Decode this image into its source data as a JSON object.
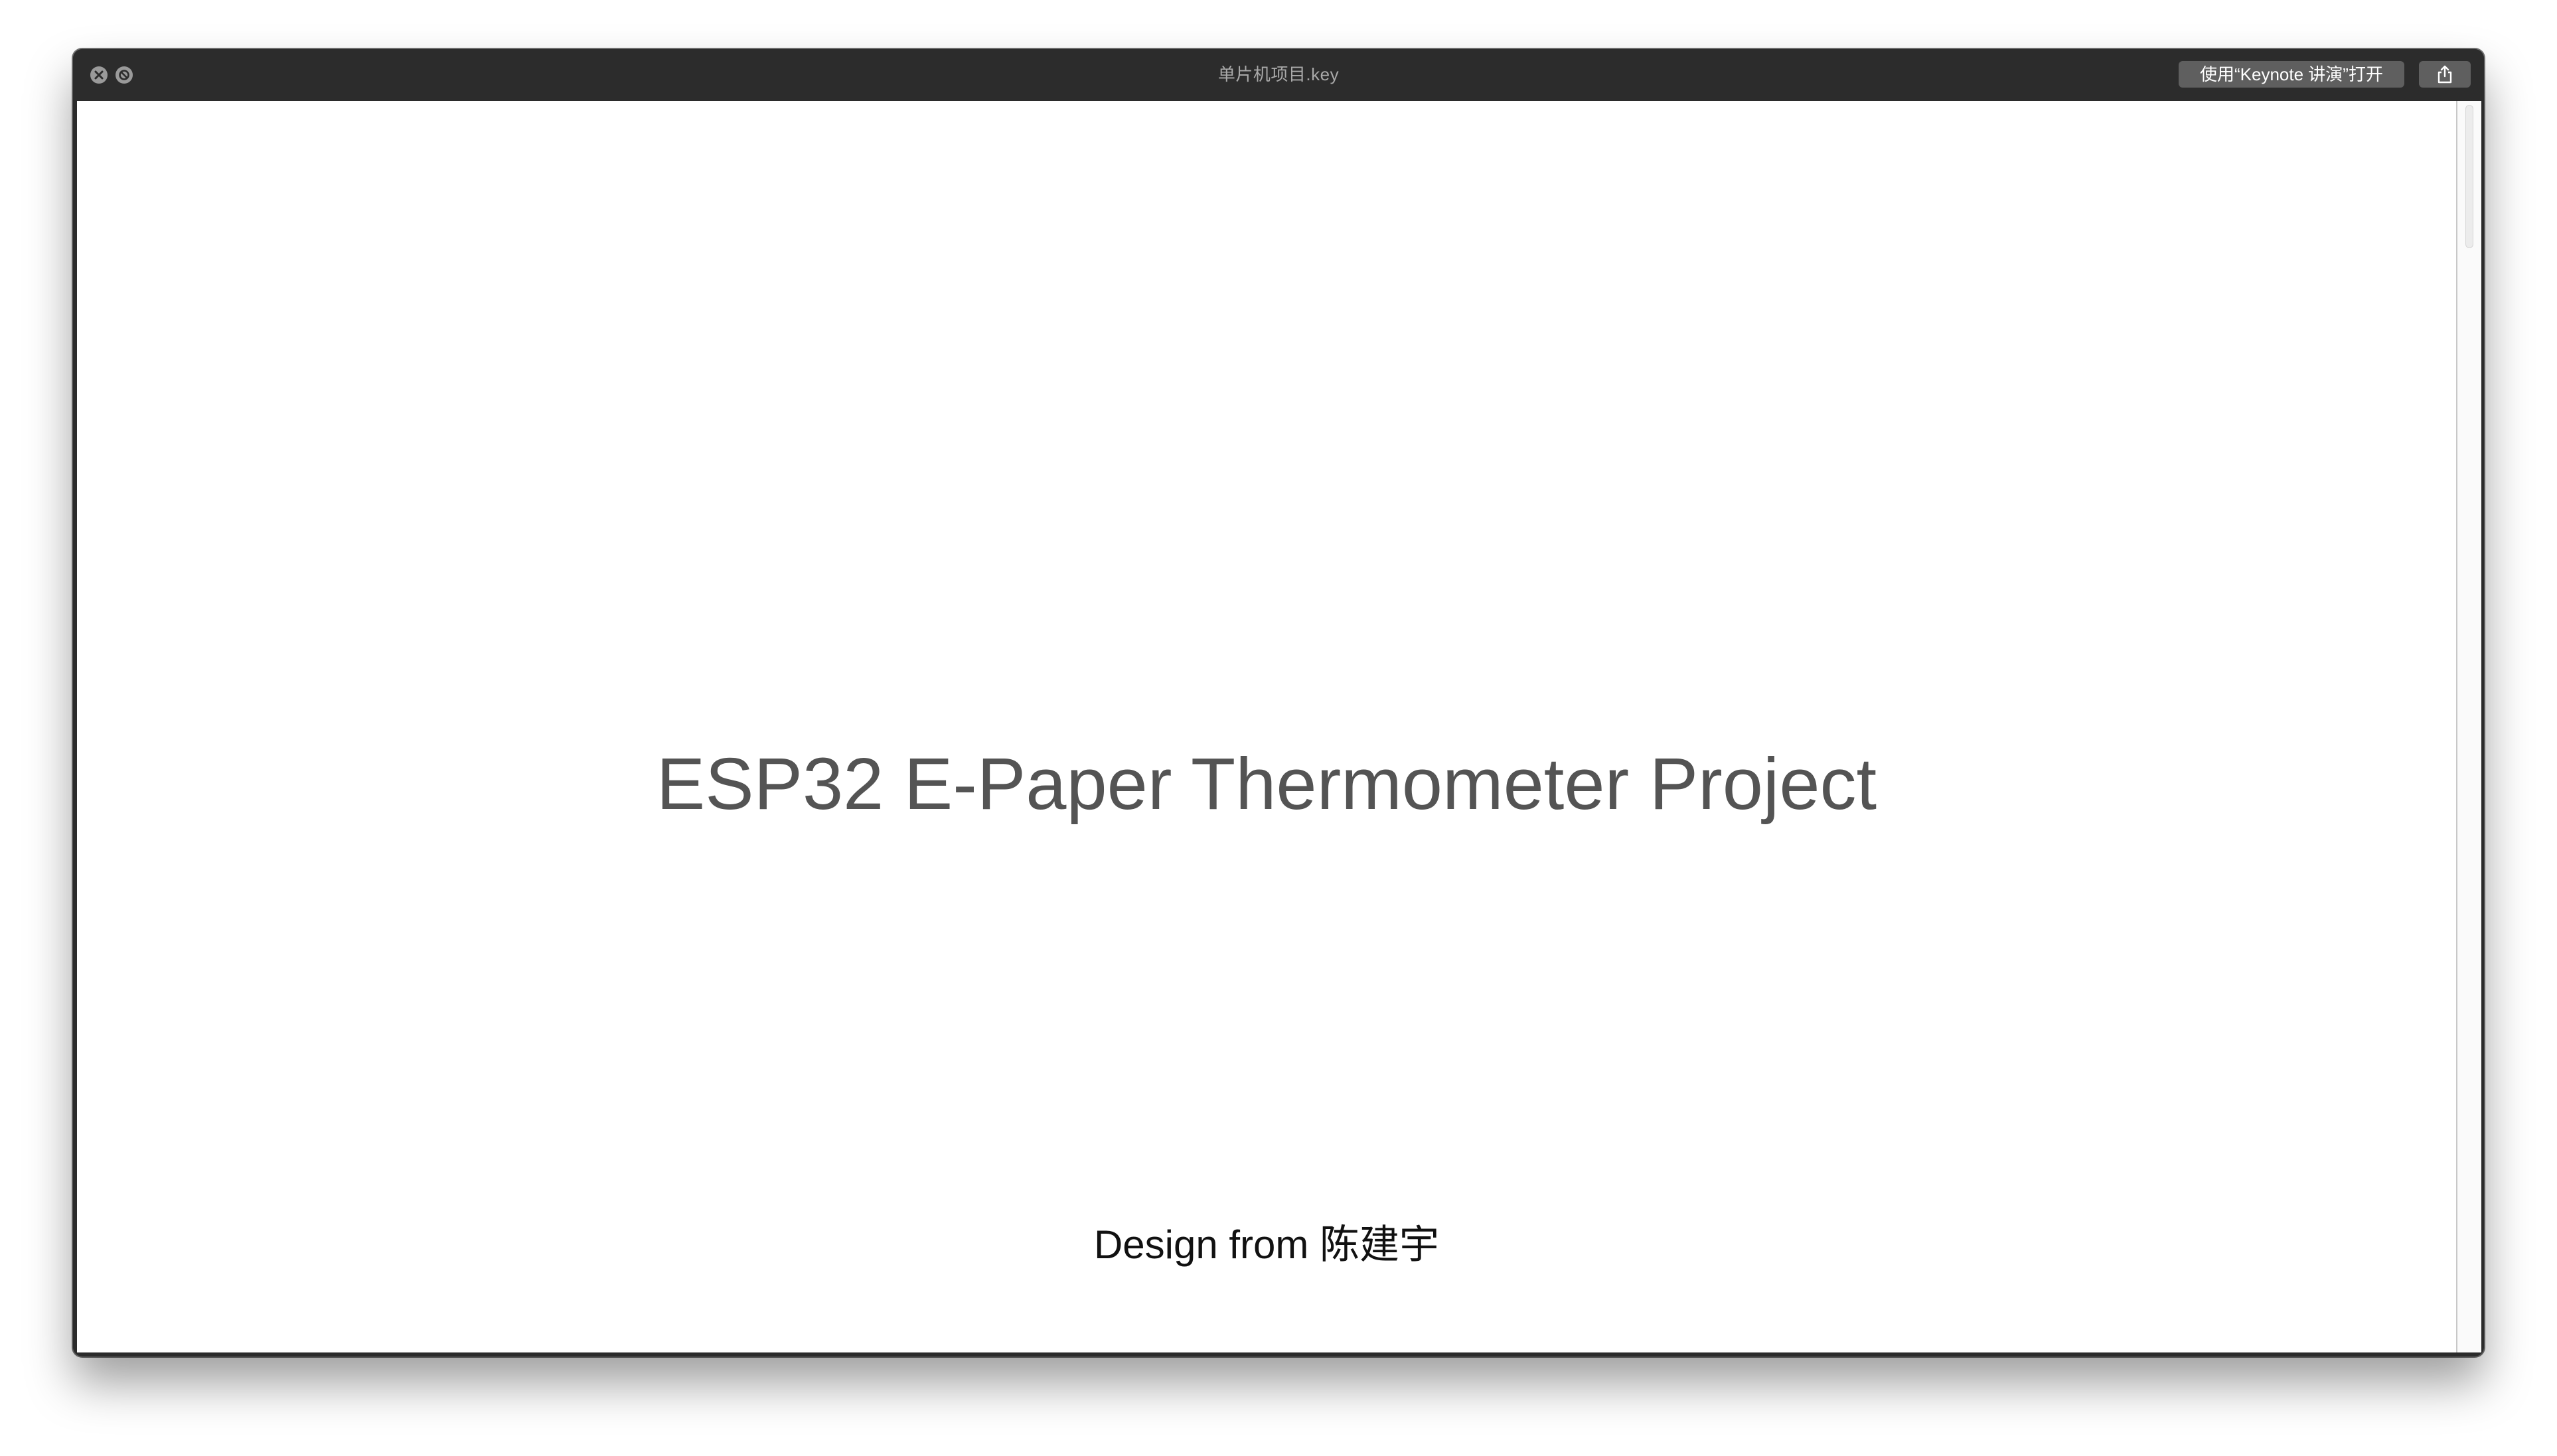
{
  "window": {
    "title": "单片机项目.key"
  },
  "toolbar": {
    "open_with_label": "使用“Keynote 讲演”打开",
    "share_icon": "share-icon",
    "close_icon": "close-icon",
    "fullscreen_disabled_icon": "no-zoom-icon"
  },
  "slide": {
    "title": "ESP32 E-Paper Thermometer Project",
    "subtitle": "Design from 陈建宇"
  },
  "colors": {
    "titlebar": "#2c2c2c",
    "button": "#5f5f5f",
    "title_text": "#545454",
    "subtitle_text": "#111111"
  }
}
